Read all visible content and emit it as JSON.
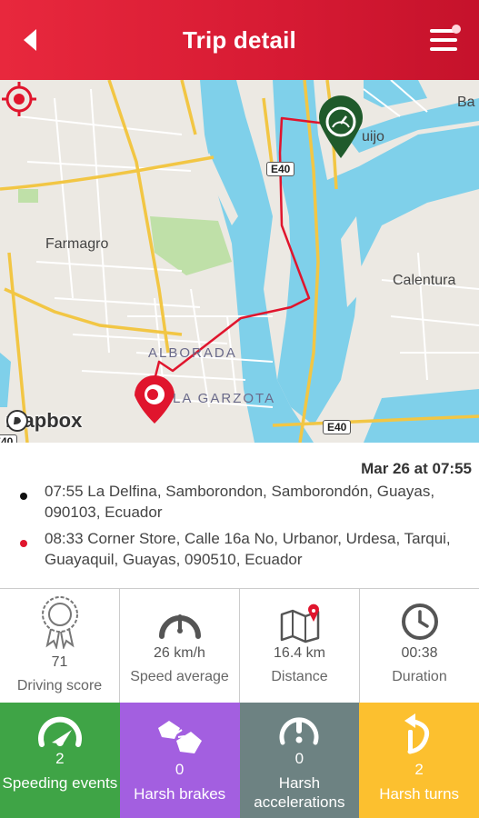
{
  "header": {
    "title": "Trip detail"
  },
  "map": {
    "labels": {
      "farmagro": "Farmagro",
      "calentura": "Calentura",
      "alborada": "ALBORADA",
      "garzota": "LA GARZOTA",
      "tuijo": "uijo",
      "ba": "Ba"
    },
    "shields": {
      "e40_top": "E40",
      "e40_bottom": "E40",
      "e40_left": "E40"
    },
    "attribution": "mapbox",
    "route_color": "#e0152d",
    "start_marker_color": "#1f5a2b",
    "end_marker_color": "#e0152d"
  },
  "trip": {
    "date": "Mar 26 at 07:55",
    "start": "07:55 La Delfina, Samborondon, Samborondón, Guayas, 090103, Ecuador",
    "end": "08:33 Corner Store, Calle 16a No, Urbanor, Urdesa, Tarqui, Guayaquil, Guayas, 090510, Ecuador",
    "start_color": "#111111",
    "end_color": "#e0152d"
  },
  "stats": [
    {
      "value": "71",
      "label": "Driving score",
      "icon": "award-ribbon-icon"
    },
    {
      "value": "26 km/h",
      "label": "Speed average",
      "icon": "speedometer-icon"
    },
    {
      "value": "16.4 km",
      "label": "Distance",
      "icon": "map-pin-icon"
    },
    {
      "value": "00:38",
      "label": "Duration",
      "icon": "clock-icon"
    }
  ],
  "events": [
    {
      "value": "2",
      "label": "Speeding events",
      "color": "#3fa446",
      "icon": "speeding-gauge-icon"
    },
    {
      "value": "0",
      "label": "Harsh brakes",
      "color": "#a35fe0",
      "icon": "car-crash-icon"
    },
    {
      "value": "0",
      "label": "Harsh accelerations",
      "color": "#6d8282",
      "icon": "alert-gauge-icon"
    },
    {
      "value": "2",
      "label": "Harsh turns",
      "color": "#fcc02f",
      "icon": "turn-arrow-icon"
    }
  ]
}
